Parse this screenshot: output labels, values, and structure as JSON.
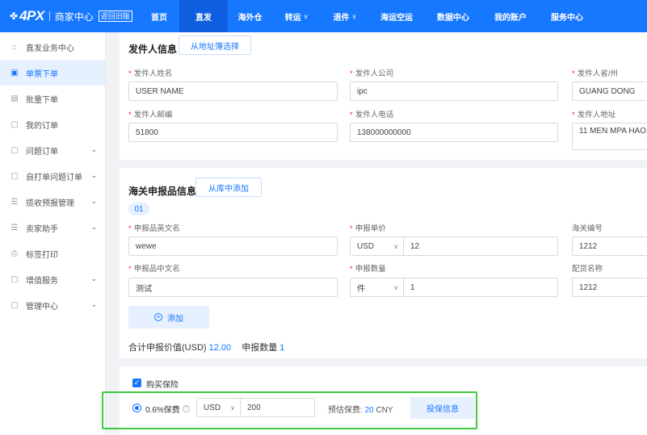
{
  "topbar": {
    "logo": "4PX",
    "logo_sub": "商家中心",
    "back_label": "返回旧版",
    "nav": [
      {
        "label": "首页",
        "chevron": ""
      },
      {
        "label": "直发",
        "chevron": ""
      },
      {
        "label": "海外仓",
        "chevron": ""
      },
      {
        "label": "转运",
        "chevron": "∨"
      },
      {
        "label": "退件",
        "chevron": "∨"
      },
      {
        "label": "海运空运",
        "chevron": ""
      },
      {
        "label": "数据中心",
        "chevron": ""
      },
      {
        "label": "我的账户",
        "chevron": ""
      },
      {
        "label": "服务中心",
        "chevron": ""
      }
    ]
  },
  "sidebar": {
    "items": [
      {
        "label": "直发业务中心",
        "icon": "home-icon"
      },
      {
        "label": "单票下单",
        "icon": "order-icon"
      },
      {
        "label": "批量下单",
        "icon": "batch-icon"
      },
      {
        "label": "我的订单",
        "icon": "list-icon"
      },
      {
        "label": "问题订单",
        "icon": "issue-icon"
      },
      {
        "label": "自打单问题订单",
        "icon": "print-issue-icon"
      },
      {
        "label": "揽收预报管理",
        "icon": "pickup-icon"
      },
      {
        "label": "卖家助手",
        "icon": "assistant-icon"
      },
      {
        "label": "标签打印",
        "icon": "printer-icon"
      },
      {
        "label": "增值服务",
        "icon": "service-icon"
      },
      {
        "label": "管理中心",
        "icon": "manage-icon"
      }
    ]
  },
  "sender": {
    "title": "发件人信息",
    "address_book_btn": "从地址簿选择",
    "name_label": "发件人姓名",
    "name_value": "USER NAME",
    "company_label": "发件人公司",
    "company_value": "ipc",
    "province_label": "发件人省/州",
    "province_value": "GUANG DONG",
    "postcode_label": "发件人邮编",
    "postcode_value": "51800",
    "phone_label": "发件人电话",
    "phone_value": "138000000000",
    "address_label": "发件人地址",
    "address_value": "11 MEN MPA HAO"
  },
  "customs": {
    "title": "海关申报品信息",
    "add_from_lib_btn": "从库中添加",
    "item_no": "01",
    "en_name_label": "申报品英文名",
    "en_name_value": "wewe",
    "unit_price_label": "申报单价",
    "currency": "USD",
    "currency_chev": "∨",
    "unit_price_value": "12",
    "hs_code_label": "海关编号",
    "hs_code_value": "1212",
    "cn_name_label": "申报品中文名",
    "cn_name_value": "测试",
    "qty_label": "申报数量",
    "qty_unit": "件",
    "qty_value": "1",
    "dist_name_label": "配货名称",
    "dist_name_value": "1212",
    "add_btn": "添加",
    "total_value_label": "合计申报价值(USD)",
    "total_value": "12.00",
    "total_qty_label": "申报数量",
    "total_qty": "1"
  },
  "insurance": {
    "buy_label": "购买保险",
    "rate_label": "0.6%保费",
    "currency": "USD",
    "currency_chev": "∨",
    "amount": "200",
    "est_label": "预估保费:",
    "est_value": "20",
    "est_unit": "CNY",
    "info_btn": "投保信息"
  },
  "colors": {
    "primary": "#1677ff",
    "highlight_box": "#3ccc3c",
    "required": "#f5222d"
  }
}
